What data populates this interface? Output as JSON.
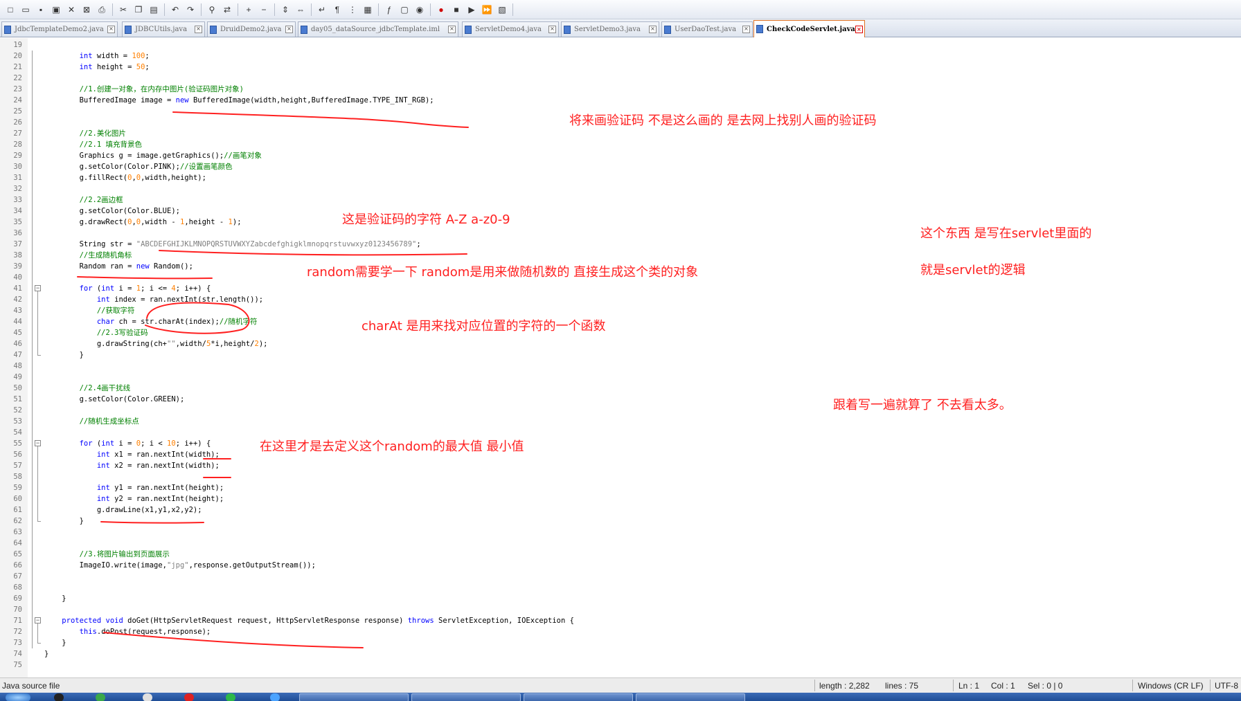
{
  "toolbar": {
    "icons": [
      "new-file",
      "open-file",
      "save",
      "save-all",
      "close",
      "close-all",
      "print",
      "cut",
      "copy",
      "paste",
      "undo",
      "redo",
      "find",
      "replace",
      "zoom-in",
      "zoom-out",
      "sync-vertical",
      "sync-horizontal",
      "word-wrap",
      "show-all-chars",
      "indent-guide",
      "user-lang",
      "function-list",
      "folder-as-workspace",
      "monitor",
      "record-macro",
      "stop-macro",
      "play-macro",
      "run-macro-multiple",
      "save-macro"
    ]
  },
  "tabs": [
    {
      "label": "JdbcTemplateDemo2.java",
      "active": false
    },
    {
      "label": "JDBCUtils.java",
      "active": false
    },
    {
      "label": "DruidDemo2.java",
      "active": false
    },
    {
      "label": "day05_dataSource_jdbcTemplate.iml",
      "active": false
    },
    {
      "label": "ServletDemo4.java",
      "active": false
    },
    {
      "label": "ServletDemo3.java",
      "active": false
    },
    {
      "label": "UserDaoTest.java",
      "active": false
    },
    {
      "label": "CheckCodeServlet.java",
      "active": true
    }
  ],
  "editor": {
    "lines": [
      {
        "n": "19",
        "code": ""
      },
      {
        "n": "20",
        "code": "        int width = 100;"
      },
      {
        "n": "21",
        "code": "        int height = 50;"
      },
      {
        "n": "22",
        "code": ""
      },
      {
        "n": "23",
        "code": "        //1.创建一对象，在内存中图片(验证码图片对象)"
      },
      {
        "n": "24",
        "code": "        BufferedImage image = new BufferedImage(width,height,BufferedImage.TYPE_INT_RGB);"
      },
      {
        "n": "25",
        "code": ""
      },
      {
        "n": "26",
        "code": ""
      },
      {
        "n": "27",
        "code": "        //2.美化图片"
      },
      {
        "n": "28",
        "code": "        //2.1 填充背景色"
      },
      {
        "n": "29",
        "code": "        Graphics g = image.getGraphics();//画笔对象"
      },
      {
        "n": "30",
        "code": "        g.setColor(Color.PINK);//设置画笔颜色"
      },
      {
        "n": "31",
        "code": "        g.fillRect(0,0,width,height);"
      },
      {
        "n": "32",
        "code": ""
      },
      {
        "n": "33",
        "code": "        //2.2画边框"
      },
      {
        "n": "34",
        "code": "        g.setColor(Color.BLUE);"
      },
      {
        "n": "35",
        "code": "        g.drawRect(0,0,width - 1,height - 1);"
      },
      {
        "n": "36",
        "code": ""
      },
      {
        "n": "37",
        "code": "        String str = \"ABCDEFGHIJKLMNOPQRSTUVWXYZabcdefghigklmnopqrstuvwxyz0123456789\";"
      },
      {
        "n": "38",
        "code": "        //生成随机角标"
      },
      {
        "n": "39",
        "code": "        Random ran = new Random();"
      },
      {
        "n": "40",
        "code": ""
      },
      {
        "n": "41",
        "code": "        for (int i = 1; i <= 4; i++) {"
      },
      {
        "n": "42",
        "code": "            int index = ran.nextInt(str.length());"
      },
      {
        "n": "43",
        "code": "            //获取字符"
      },
      {
        "n": "44",
        "code": "            char ch = str.charAt(index);//随机字符"
      },
      {
        "n": "45",
        "code": "            //2.3写验证码"
      },
      {
        "n": "46",
        "code": "            g.drawString(ch+\"\",width/5*i,height/2);"
      },
      {
        "n": "47",
        "code": "        }"
      },
      {
        "n": "48",
        "code": ""
      },
      {
        "n": "49",
        "code": ""
      },
      {
        "n": "50",
        "code": "        //2.4画干扰线"
      },
      {
        "n": "51",
        "code": "        g.setColor(Color.GREEN);"
      },
      {
        "n": "52",
        "code": ""
      },
      {
        "n": "53",
        "code": "        //随机生成坐标点"
      },
      {
        "n": "54",
        "code": ""
      },
      {
        "n": "55",
        "code": "        for (int i = 0; i < 10; i++) {"
      },
      {
        "n": "56",
        "code": "            int x1 = ran.nextInt(width);"
      },
      {
        "n": "57",
        "code": "            int x2 = ran.nextInt(width);"
      },
      {
        "n": "58",
        "code": ""
      },
      {
        "n": "59",
        "code": "            int y1 = ran.nextInt(height);"
      },
      {
        "n": "60",
        "code": "            int y2 = ran.nextInt(height);"
      },
      {
        "n": "61",
        "code": "            g.drawLine(x1,y1,x2,y2);"
      },
      {
        "n": "62",
        "code": "        }"
      },
      {
        "n": "63",
        "code": ""
      },
      {
        "n": "64",
        "code": ""
      },
      {
        "n": "65",
        "code": "        //3.将图片输出到页面展示"
      },
      {
        "n": "66",
        "code": "        ImageIO.write(image,\"jpg\",response.getOutputStream());"
      },
      {
        "n": "67",
        "code": ""
      },
      {
        "n": "68",
        "code": ""
      },
      {
        "n": "69",
        "code": "    }"
      },
      {
        "n": "70",
        "code": ""
      },
      {
        "n": "71",
        "code": "    protected void doGet(HttpServletRequest request, HttpServletResponse response) throws ServletException, IOException {"
      },
      {
        "n": "72",
        "code": "        this.doPost(request,response);"
      },
      {
        "n": "73",
        "code": "    }"
      },
      {
        "n": "74",
        "code": "}"
      },
      {
        "n": "75",
        "code": ""
      }
    ]
  },
  "annotations": {
    "note1": "将来画验证码 不是这么画的  是去网上找别人画的验证码",
    "note2": "这是验证码的字符  A-Z a-z0-9",
    "note3": "这个东西 是写在servlet里面的",
    "note4": "random需要学一下  random是用来做随机数的  直接生成这个类的对象",
    "note5": "就是servlet的逻辑",
    "note6": "charAt  是用来找对应位置的字符的一个函数",
    "note7": "跟着写一遍就算了 不去看太多。",
    "note8": "在这里才是去定义这个random的最大值 最小值",
    "color": "#ff2020"
  },
  "status": {
    "file_type": "Java source file",
    "length": "length : 2,282",
    "lines": "lines : 75",
    "ln": "Ln : 1",
    "col": "Col : 1",
    "sel": "Sel : 0 | 0",
    "eol": "Windows (CR LF)",
    "encoding": "UTF-8"
  },
  "colors": {
    "keyword": "#0000ff",
    "number": "#ff8000",
    "string": "#808080",
    "comment": "#008000",
    "active_tab_border": "#e07020"
  }
}
